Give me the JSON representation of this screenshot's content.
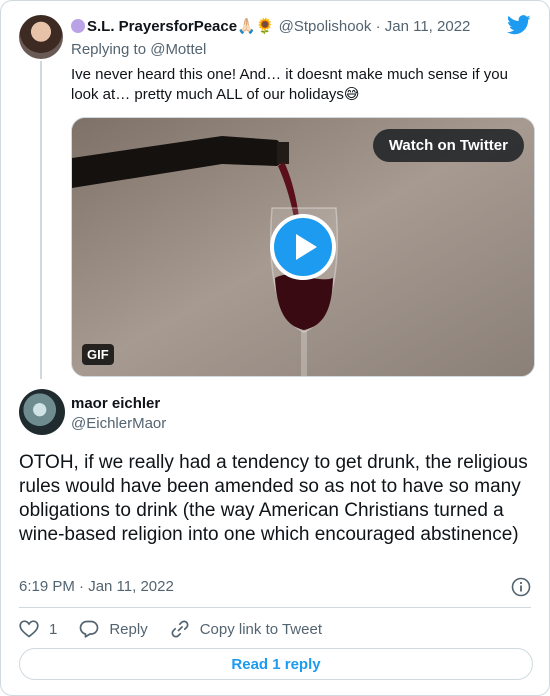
{
  "parent_tweet": {
    "author_name": "S.L. PrayersforPeace",
    "name_emojis": "🙏🏻🌻",
    "handle": "@Stpolishook",
    "separator": "·",
    "date": "Jan 11, 2022",
    "replying_to": "Replying to @Mottel",
    "text": "Ive never heard this one! And… it doesnt make much sense if you look at… pretty much ALL of our holidays😅",
    "media": {
      "watch_label": "Watch on Twitter",
      "badge": "GIF"
    }
  },
  "main_tweet": {
    "author_name": "maor eichler",
    "handle": "@EichlerMaor",
    "text": "OTOH, if we really had a tendency to get drunk, the religious rules would have been amended so as not to have so many obligations to drink (the way American Christians turned a wine-based religion into one which encouraged abstinence)",
    "timestamp": "6:19 PM · Jan 11, 2022"
  },
  "actions": {
    "like_count": "1",
    "reply_label": "Reply",
    "copy_link_label": "Copy link to Tweet"
  },
  "read_reply_label": "Read 1 reply",
  "colors": {
    "brand": "#1d9bf0",
    "muted": "#536471",
    "border": "#cfd9de"
  }
}
